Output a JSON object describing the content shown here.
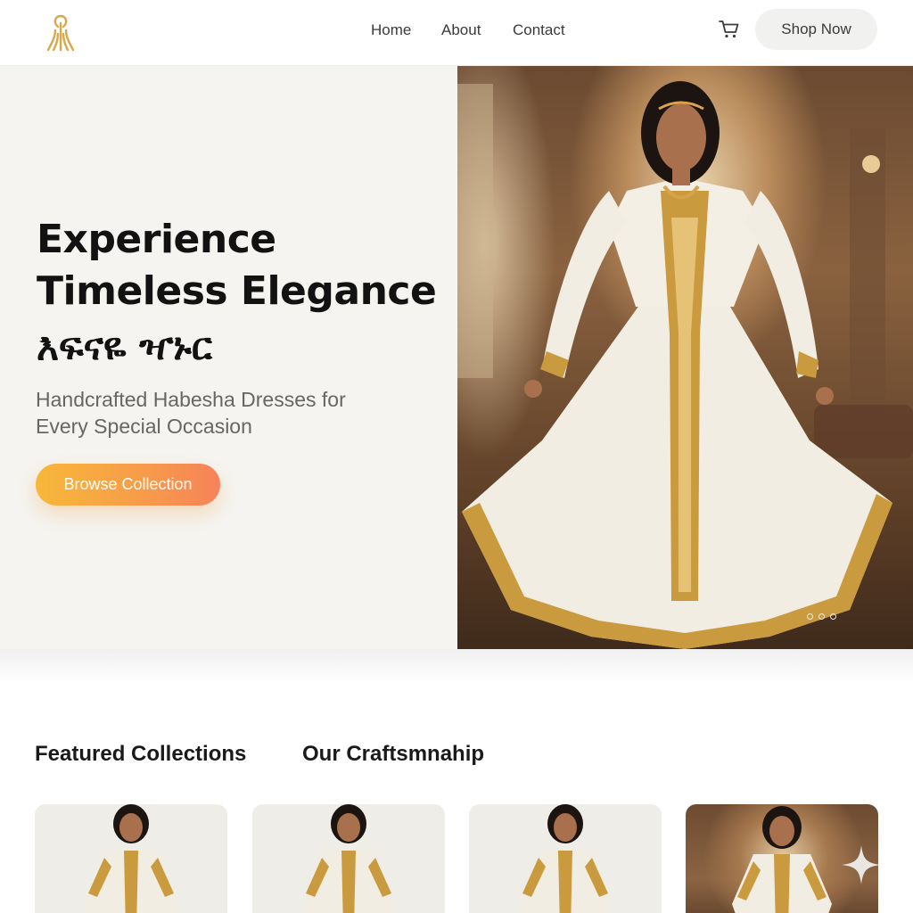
{
  "nav": {
    "logo_icon": "golden-tree-logo-icon",
    "links": [
      {
        "label": "Home"
      },
      {
        "label": "About"
      },
      {
        "label": "Contact"
      }
    ],
    "cart_icon": "cart-icon",
    "shop_now_label": "Shop Now"
  },
  "hero": {
    "title_line1": "Experience",
    "title_line2": "Timeless Elegance",
    "amharic": "እፍናዬ ዣኑር",
    "subtitle_line1": "Handcrafted Habesha Dresses for",
    "subtitle_line2": "Every Special Occasion",
    "cta_label": "Browse Collection",
    "image_alt": "woman-in-habesha-dress-image",
    "carousel_dots": 3
  },
  "sections": {
    "featured_title": "Featured Collections",
    "craftsmanship_title": "Our Craftsmnahip"
  },
  "cards": [
    {
      "image": "habesha-dress-model-image"
    },
    {
      "image": "habesha-dress-model-image"
    },
    {
      "image": "habesha-dress-model-image"
    },
    {
      "image": "habesha-dress-model-image"
    }
  ],
  "colors": {
    "accent_gradient_start": "#f7b83a",
    "accent_gradient_end": "#f6835a",
    "logo_gold": "#d9a84a",
    "hero_left_bg": "#f5f4f0"
  }
}
